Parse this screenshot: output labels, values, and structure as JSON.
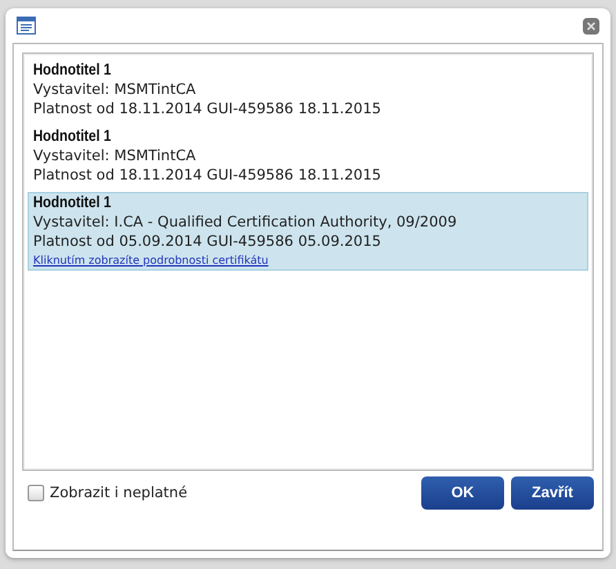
{
  "certificates": [
    {
      "title": "Hodnotitel 1",
      "issuer": "Vystavitel: MSMTintCA",
      "validity": "Platnost od 18.11.2014 GUI-459586 18.11.2015",
      "selected": false
    },
    {
      "title": "Hodnotitel 1",
      "issuer": "Vystavitel: MSMTintCA",
      "validity": "Platnost od 18.11.2014 GUI-459586 18.11.2015",
      "selected": false
    },
    {
      "title": "Hodnotitel 1",
      "issuer": "Vystavitel: I.CA - Qualified Certification Authority, 09/2009",
      "validity": "Platnost od 05.09.2014 GUI-459586 05.09.2015",
      "selected": true,
      "link": "Kliknutím zobrazíte podrobnosti certifikátu"
    }
  ],
  "show_invalid": {
    "label": "Zobrazit i neplatné",
    "checked": false
  },
  "buttons": [
    "OK",
    "Zavřít"
  ]
}
